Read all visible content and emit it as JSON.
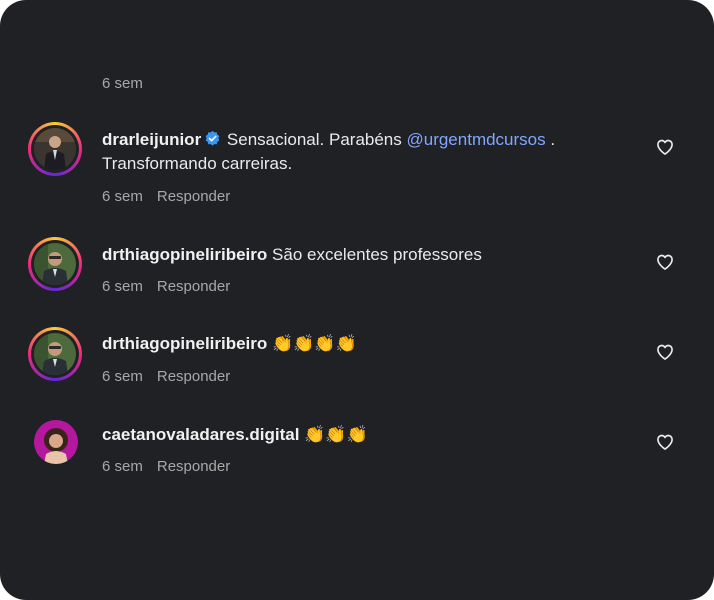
{
  "top_meta": {
    "time": "6 sem"
  },
  "comments": [
    {
      "username": "drarleijunior",
      "verified": true,
      "text_before": "Sensacional. Parabéns ",
      "mention": "@urgentmdcursos",
      "text_after": " .",
      "line2": "Transformando carreiras.",
      "time": "6 sem",
      "reply_label": "Responder",
      "like_icon": "heart-outline-icon"
    },
    {
      "username": "drthiagopineliribeiro",
      "text": "São excelentes professores",
      "time": "6 sem",
      "reply_label": "Responder",
      "like_icon": "heart-outline-icon"
    },
    {
      "username": "drthiagopineliribeiro",
      "emojis": [
        "👏",
        "👏",
        "👏",
        "👏"
      ],
      "time": "6 sem",
      "reply_label": "Responder",
      "like_icon": "heart-outline-icon"
    },
    {
      "username": "caetanovaladares.digital",
      "emojis": [
        "👏",
        "👏",
        "👏"
      ],
      "time": "6 sem",
      "reply_label": "Responder",
      "like_icon": "heart-outline-icon"
    }
  ],
  "colors": {
    "background": "#202124",
    "text": "#e8eaed",
    "muted": "#a8a8a8",
    "mention": "#82a6ff",
    "verified": "#3897f0"
  }
}
